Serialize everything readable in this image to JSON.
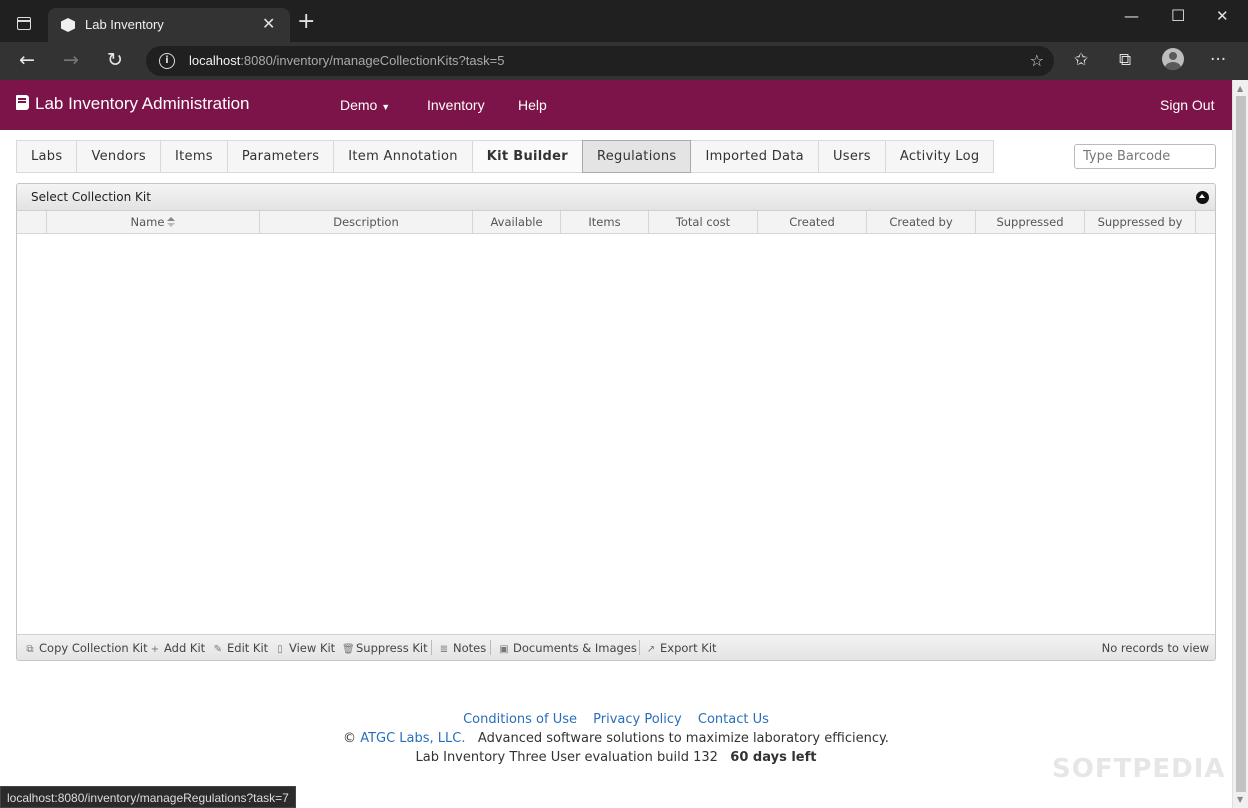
{
  "browser": {
    "tab_title": "Lab Inventory",
    "url_host": "localhost",
    "url_path": ":8080/inventory/manageCollectionKits?task=5",
    "status_url": "localhost:8080/inventory/manageRegulations?task=7"
  },
  "header": {
    "brand": "Lab Inventory Administration",
    "nav": {
      "demo": "Demo",
      "inventory": "Inventory",
      "help": "Help",
      "signout": "Sign Out"
    }
  },
  "tabs": [
    "Labs",
    "Vendors",
    "Items",
    "Parameters",
    "Item Annotation",
    "Kit Builder",
    "Regulations",
    "Imported Data",
    "Users",
    "Activity Log"
  ],
  "search": {
    "placeholder": "Type Barcode"
  },
  "grid": {
    "caption": "Select Collection Kit",
    "columns": [
      "Name",
      "Description",
      "Available",
      "Items",
      "Total cost",
      "Created",
      "Created by",
      "Suppressed",
      "Suppressed by"
    ],
    "pager": {
      "copy": "Copy Collection Kit",
      "add": "Add Kit",
      "edit": "Edit Kit",
      "view": "View Kit",
      "suppress": "Suppress Kit",
      "notes": "Notes",
      "docs": "Documents & Images",
      "export": "Export Kit",
      "records": "No records to view"
    }
  },
  "footer": {
    "links": [
      "Conditions of Use",
      "Privacy Policy",
      "Contact Us"
    ],
    "copyright_symbol": "©",
    "company": "ATGC Labs, LLC.",
    "tagline": "Advanced software solutions to maximize laboratory efficiency.",
    "build": "Lab Inventory Three User evaluation build 132",
    "days_left": "60 days left"
  },
  "watermark": "SOFTPEDIA",
  "colors": {
    "brand": "#7d1449",
    "link": "#2a6ebb"
  }
}
